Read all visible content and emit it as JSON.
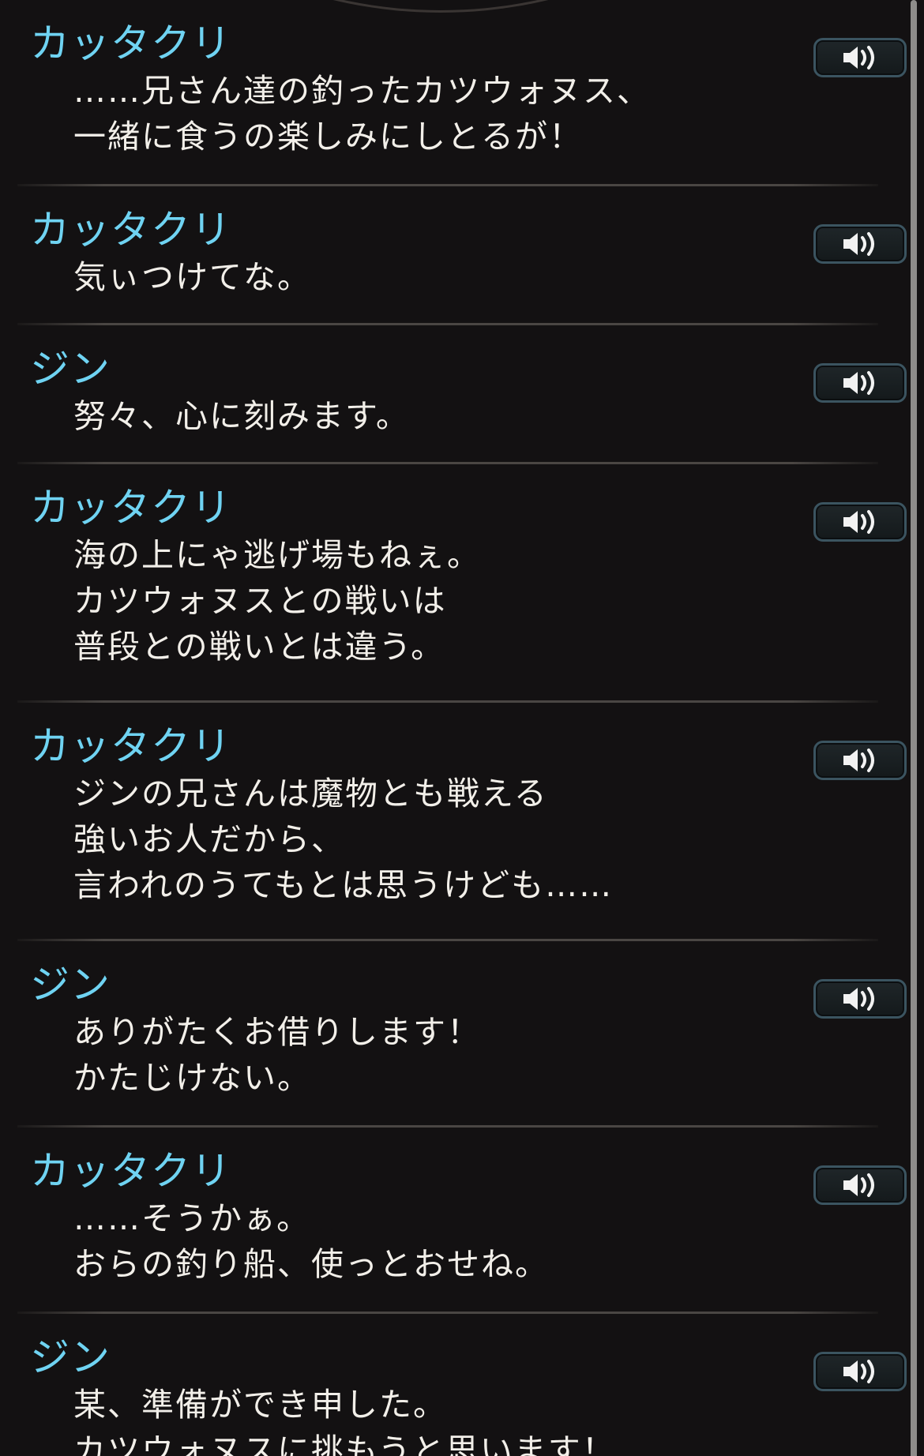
{
  "scroll": {
    "position": 0.0
  },
  "entries": [
    {
      "speaker": "カッタクリ",
      "lines": [
        "……兄さん達の釣ったカツウォヌス、",
        "一緒に食うの楽しみにしとるが！"
      ],
      "voice_icon": "speaker-icon"
    },
    {
      "speaker": "カッタクリ",
      "lines": [
        "気ぃつけてな。"
      ],
      "voice_icon": "speaker-icon"
    },
    {
      "speaker": "ジン",
      "lines": [
        "努々、心に刻みます。"
      ],
      "voice_icon": "speaker-icon"
    },
    {
      "speaker": "カッタクリ",
      "lines": [
        "海の上にゃ逃げ場もねぇ。",
        "カツウォヌスとの戦いは",
        "普段との戦いとは違う。"
      ],
      "voice_icon": "speaker-icon"
    },
    {
      "speaker": "カッタクリ",
      "lines": [
        "ジンの兄さんは魔物とも戦える",
        "強いお人だから、",
        "言われのうてもとは思うけども……"
      ],
      "voice_icon": "speaker-icon"
    },
    {
      "speaker": "ジン",
      "lines": [
        "ありがたくお借りします！",
        "かたじけない。"
      ],
      "voice_icon": "speaker-icon"
    },
    {
      "speaker": "カッタクリ",
      "lines": [
        "……そうかぁ。",
        "おらの釣り船、使っとおせね。"
      ],
      "voice_icon": "speaker-icon"
    },
    {
      "speaker": "ジン",
      "lines": [
        "某、準備ができ申した。",
        "カツウォヌスに挑もうと思います！"
      ],
      "voice_icon": "speaker-icon"
    }
  ],
  "colors": {
    "background": "#131112",
    "speaker": "#6fd3f2",
    "text": "#f2efe9",
    "button_border": "#3b5460",
    "divider": "#4a4643",
    "scrollbar": "#8e8c8a"
  }
}
